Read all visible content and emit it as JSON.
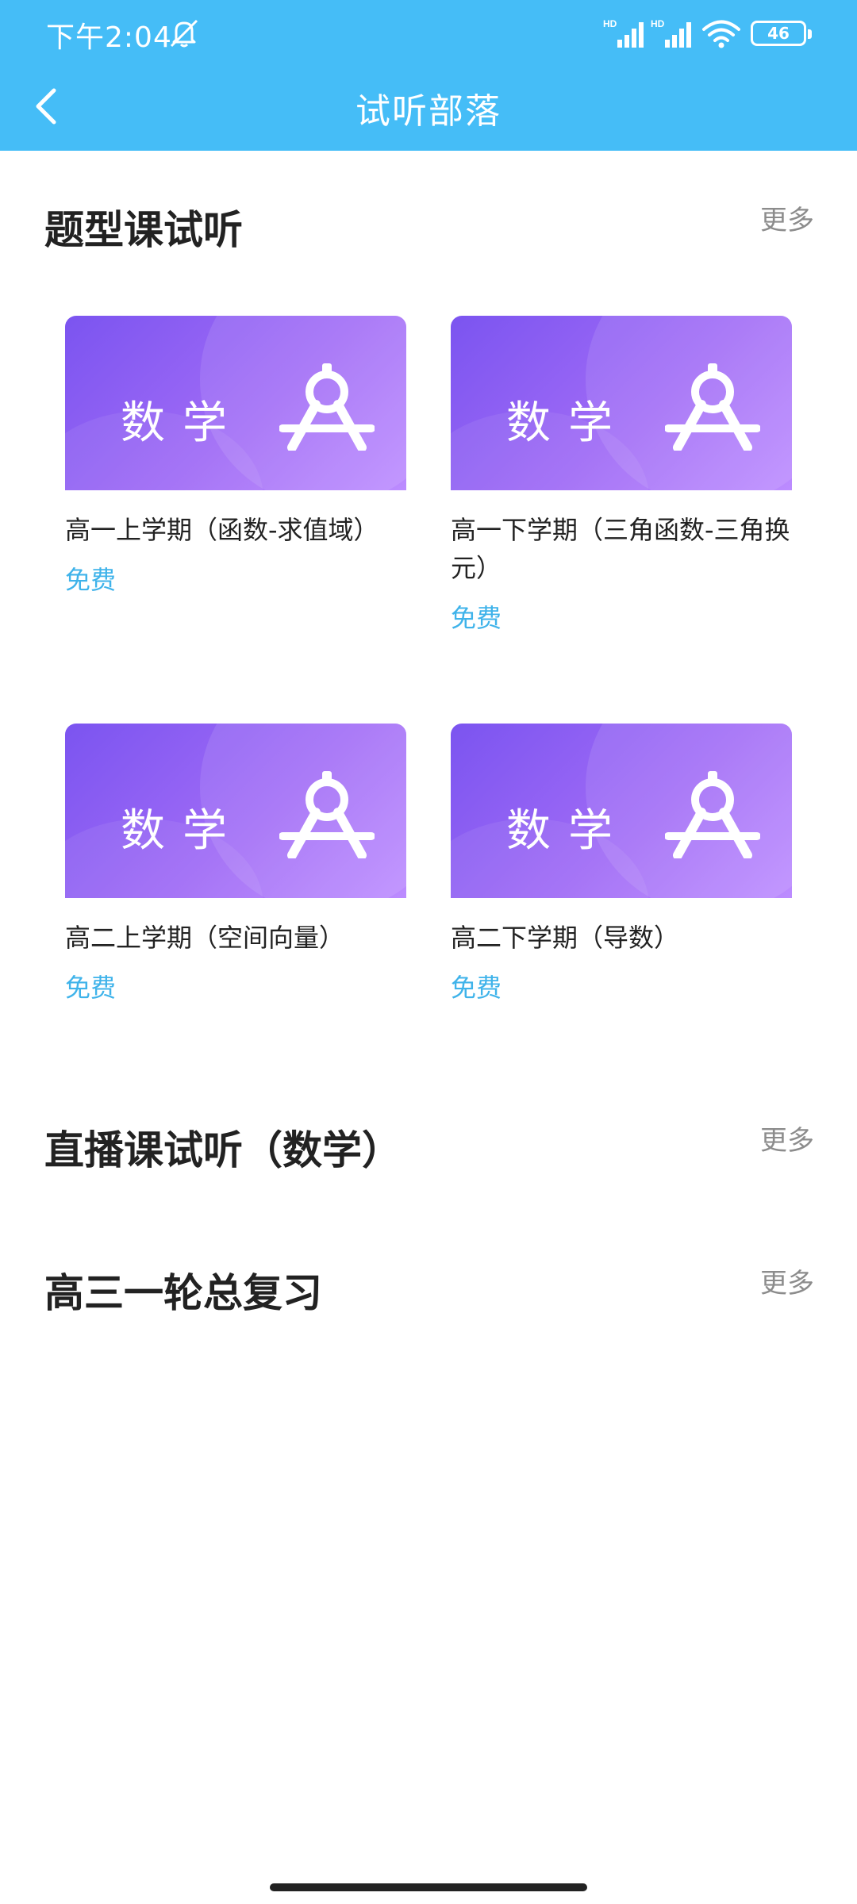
{
  "status_bar": {
    "time": "下午2:04",
    "signal_1_label": "HD",
    "signal_2_label": "HD",
    "battery": "46"
  },
  "nav": {
    "title": "试听部落"
  },
  "sections": [
    {
      "title": "题型课试听",
      "more": "更多",
      "cards": [
        {
          "subject": "数学",
          "title": "高一上学期（函数-求值域）",
          "price": "免费"
        },
        {
          "subject": "数学",
          "title": "高一下学期（三角函数-三角换元）",
          "price": "免费"
        },
        {
          "subject": "数学",
          "title": "高二上学期（空间向量）",
          "price": "免费"
        },
        {
          "subject": "数学",
          "title": "高二下学期（导数）",
          "price": "免费"
        }
      ]
    },
    {
      "title": "直播课试听（数学）",
      "more": "更多"
    },
    {
      "title": "高三一轮总复习",
      "more": "更多"
    }
  ],
  "colors": {
    "header": "#45bdf7",
    "price": "#3fb3ea",
    "card_gradient_start": "#7b54f0",
    "card_gradient_end": "#bc8cff"
  }
}
